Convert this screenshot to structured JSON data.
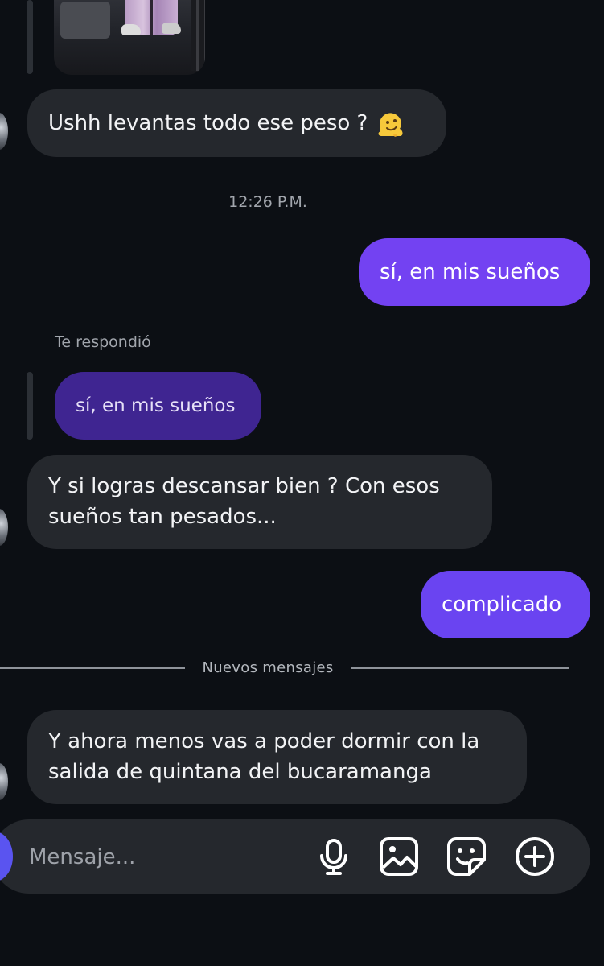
{
  "messages": {
    "m1_text": "Ushh levantas todo ese peso ?",
    "timestamp": "12:26 P.M.",
    "m2_text": "sí, en mis sueños",
    "replied_label": "Te respondió",
    "quoted_text": "sí, en mis sueños",
    "m3_line1": "Y si logras descansar bien ? Con esos",
    "m3_line2": "sueños tan pesados...",
    "m4_text": "complicado",
    "new_messages_label": "Nuevos mensajes",
    "m5_line1": "Y ahora menos vas a poder dormir con la",
    "m5_line2": "salida de quintana del bucaramanga"
  },
  "composer": {
    "placeholder": "Mensaje..."
  },
  "icons": {
    "emoji": "melting-face-emoji",
    "mic": "microphone-icon",
    "gallery": "gallery-icon",
    "sticker": "sticker-icon",
    "add": "plus-circle-icon"
  },
  "colors": {
    "background": "#0c0f14",
    "incoming_bubble": "#25282d",
    "outgoing_bubble": "#6e3ff2",
    "quoted_bubble": "#3f2591"
  }
}
